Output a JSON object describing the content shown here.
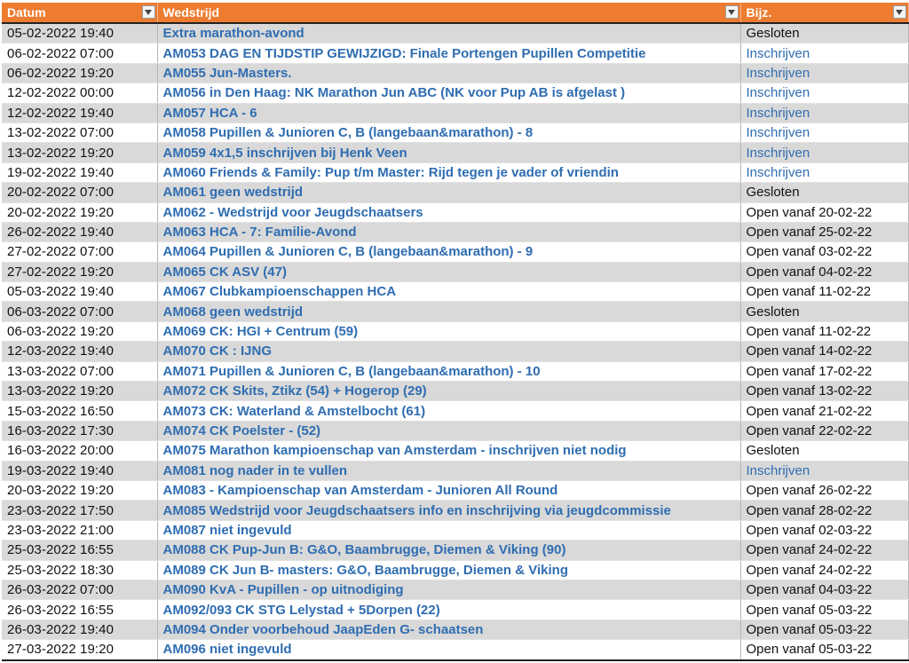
{
  "header": {
    "date_label": "Datum",
    "event_label": "Wedstrijd",
    "note_label": "Bijz."
  },
  "colors": {
    "header_bg": "#ee7c30",
    "link": "#2f6db1",
    "row_stripe": "#d9d9d9"
  },
  "rows": [
    {
      "date": "05-02-2022 19:40",
      "event": "Extra marathon-avond",
      "note": "Gesloten",
      "note_link": false
    },
    {
      "date": "06-02-2022 07:00",
      "event": "AM053 DAG EN TIJDSTIP GEWIJZIGD: Finale Portengen Pupillen Competitie",
      "note": "Inschrijven",
      "note_link": true
    },
    {
      "date": "06-02-2022 19:20",
      "event": "AM055 Jun-Masters.",
      "note": "Inschrijven",
      "note_link": true
    },
    {
      "date": "12-02-2022 00:00",
      "event": "AM056 in Den Haag: NK Marathon Jun ABC (NK voor Pup AB is afgelast )",
      "note": "Inschrijven",
      "note_link": true
    },
    {
      "date": "12-02-2022 19:40",
      "event": "AM057 HCA - 6",
      "note": "Inschrijven",
      "note_link": true
    },
    {
      "date": "13-02-2022 07:00",
      "event": "AM058 Pupillen & Junioren C, B (langebaan&marathon) - 8",
      "note": "Inschrijven",
      "note_link": true
    },
    {
      "date": "13-02-2022 19:20",
      "event": "AM059 4x1,5 inschrijven bij Henk Veen",
      "note": "Inschrijven",
      "note_link": true
    },
    {
      "date": "19-02-2022 19:40",
      "event": "AM060 Friends & Family: Pup t/m Master: Rijd tegen je vader of vriendin",
      "note": "Inschrijven",
      "note_link": true
    },
    {
      "date": "20-02-2022 07:00",
      "event": "AM061 geen wedstrijd",
      "note": "Gesloten",
      "note_link": false
    },
    {
      "date": "20-02-2022 19:20",
      "event": "AM062 - Wedstrijd voor Jeugdschaatsers",
      "note": "Open vanaf 20-02-22",
      "note_link": false
    },
    {
      "date": "26-02-2022 19:40",
      "event": "AM063 HCA - 7: Familie-Avond",
      "note": "Open vanaf 25-02-22",
      "note_link": false
    },
    {
      "date": "27-02-2022 07:00",
      "event": "AM064 Pupillen & Junioren C, B (langebaan&marathon) - 9",
      "note": "Open vanaf 03-02-22",
      "note_link": false
    },
    {
      "date": "27-02-2022 19:20",
      "event": "AM065 CK ASV (47)",
      "note": "Open vanaf 04-02-22",
      "note_link": false
    },
    {
      "date": "05-03-2022 19:40",
      "event": "AM067 Clubkampioenschappen HCA",
      "note": "Open vanaf 11-02-22",
      "note_link": false
    },
    {
      "date": "06-03-2022 07:00",
      "event": "AM068 geen wedstrijd",
      "note": "Gesloten",
      "note_link": false
    },
    {
      "date": "06-03-2022 19:20",
      "event": "AM069 CK: HGI + Centrum (59)",
      "note": "Open vanaf 11-02-22",
      "note_link": false
    },
    {
      "date": "12-03-2022 19:40",
      "event": "AM070 CK : IJNG",
      "note": "Open vanaf 14-02-22",
      "note_link": false
    },
    {
      "date": "13-03-2022 07:00",
      "event": "AM071 Pupillen & Junioren C, B (langebaan&marathon) - 10",
      "note": "Open vanaf 17-02-22",
      "note_link": false
    },
    {
      "date": "13-03-2022 19:20",
      "event": "AM072 CK Skits, Ztikz (54) + Hogerop (29)",
      "note": "Open vanaf 13-02-22",
      "note_link": false
    },
    {
      "date": "15-03-2022 16:50",
      "event": "AM073 CK: Waterland & Amstelbocht (61)",
      "note": "Open vanaf 21-02-22",
      "note_link": false
    },
    {
      "date": "16-03-2022 17:30",
      "event": "AM074 CK Poelster - (52)",
      "note": "Open vanaf 22-02-22",
      "note_link": false
    },
    {
      "date": "16-03-2022 20:00",
      "event": "AM075 Marathon kampioenschap van Amsterdam - inschrijven niet nodig",
      "note": "Gesloten",
      "note_link": false
    },
    {
      "date": "19-03-2022 19:40",
      "event": "AM081 nog nader in te vullen",
      "note": "Inschrijven",
      "note_link": true
    },
    {
      "date": "20-03-2022 19:20",
      "event": "AM083 - Kampioenschap van Amsterdam - Junioren All Round",
      "note": "Open vanaf 26-02-22",
      "note_link": false
    },
    {
      "date": "23-03-2022 17:50",
      "event": "AM085 Wedstrijd voor Jeugdschaatsers info en inschrijving via jeugdcommissie",
      "note": "Open vanaf 28-02-22",
      "note_link": false
    },
    {
      "date": "23-03-2022 21:00",
      "event": "AM087 niet ingevuld",
      "note": "Open vanaf 02-03-22",
      "note_link": false
    },
    {
      "date": "25-03-2022 16:55",
      "event": "AM088 CK Pup-Jun B: G&O, Baambrugge, Diemen & Viking (90)",
      "note": "Open vanaf 24-02-22",
      "note_link": false
    },
    {
      "date": "25-03-2022 18:30",
      "event": "AM089 CK Jun B- masters: G&O, Baambrugge, Diemen & Viking",
      "note": "Open vanaf 24-02-22",
      "note_link": false
    },
    {
      "date": "26-03-2022 07:00",
      "event": "AM090 KvA - Pupillen - op uitnodiging",
      "note": "Open vanaf 04-03-22",
      "note_link": false
    },
    {
      "date": "26-03-2022 16:55",
      "event": "AM092/093 CK STG Lelystad + 5Dorpen (22)",
      "note": "Open vanaf 05-03-22",
      "note_link": false
    },
    {
      "date": "26-03-2022 19:40",
      "event": "AM094 Onder voorbehoud JaapEden G- schaatsen",
      "note": "Open vanaf 05-03-22",
      "note_link": false
    },
    {
      "date": "27-03-2022 19:20",
      "event": "AM096 niet ingevuld",
      "note": "Open vanaf 05-03-22",
      "note_link": false
    }
  ]
}
